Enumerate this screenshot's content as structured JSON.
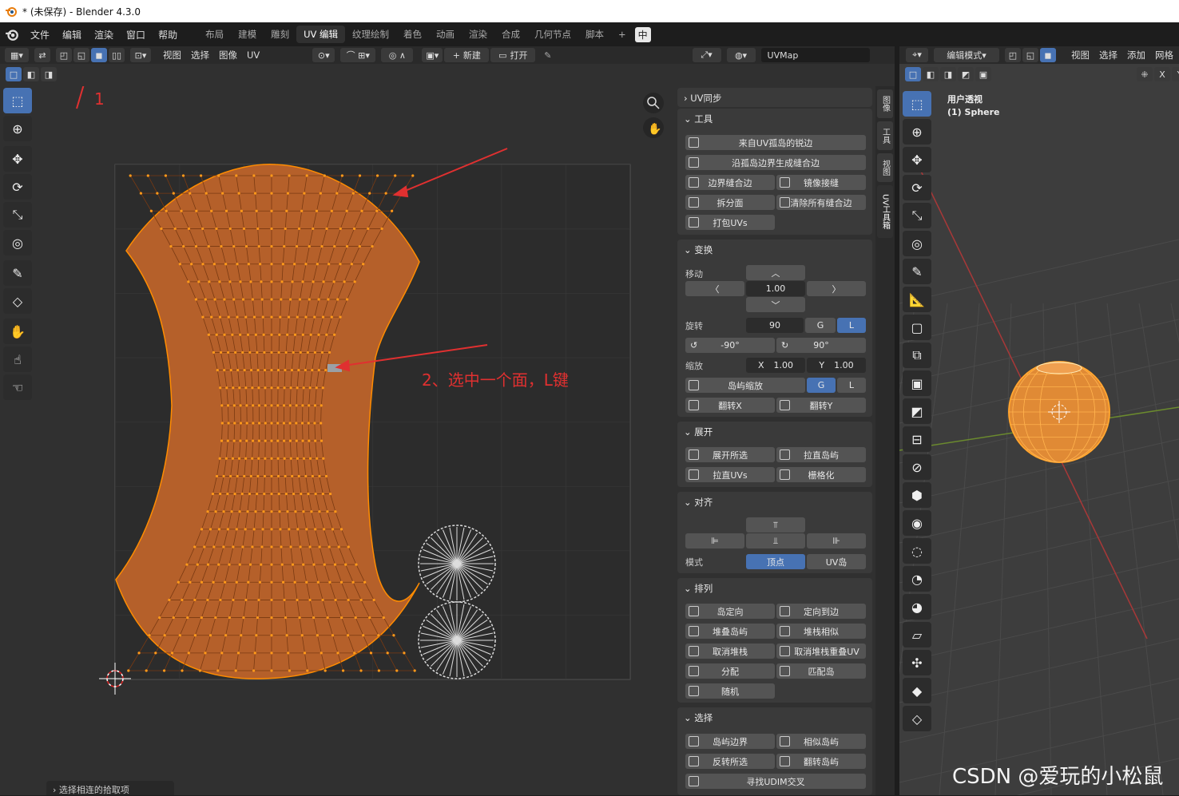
{
  "window": {
    "title": "* (未保存) - Blender 4.3.0"
  },
  "menubar": {
    "menus": [
      "文件",
      "编辑",
      "渲染",
      "窗口",
      "帮助"
    ],
    "workspaces": [
      "布局",
      "建模",
      "雕刻",
      "UV 编辑",
      "纹理绘制",
      "着色",
      "动画",
      "渲染",
      "合成",
      "几何节点",
      "脚本"
    ],
    "active_workspace": "UV 编辑",
    "add_tab": "+",
    "ime": "中"
  },
  "uv_header": {
    "menus": [
      "视图",
      "选择",
      "图像",
      "UV"
    ],
    "new_label": "新建",
    "open_label": "打开",
    "uvmap": "UVMap"
  },
  "annotations": {
    "one": "1",
    "two": "2、选中一个面，L键"
  },
  "npanel": {
    "uv_sync": "UV同步",
    "tools": {
      "title": "工具",
      "seams_from_islands": "来自UV孤岛的锐边",
      "seams_from_border": "沿孤岛边界生成缝合边",
      "border_seam": "边界缝合边",
      "mirror_seam": "镜像接缝",
      "split_faces": "拆分面",
      "clear_seams": "清除所有缝合边",
      "pack_uvs": "打包UVs"
    },
    "transform": {
      "title": "变换",
      "move": "移动",
      "move_value": "1.00",
      "rotate": "旋转",
      "rotate_value": "90",
      "g": "G",
      "l": "L",
      "rot_neg": "-90°",
      "rot_pos": "90°",
      "scale": "缩放",
      "x": "X",
      "y": "Y",
      "scale_x": "1.00",
      "scale_y": "1.00",
      "island_scale": "岛屿缩放",
      "flip_x": "翻转X",
      "flip_y": "翻转Y"
    },
    "unwrap": {
      "title": "展开",
      "unwrap_sel": "展开所选",
      "straighten_island": "拉直岛屿",
      "straighten_uvs": "拉直UVs",
      "grid": "栅格化"
    },
    "align": {
      "title": "对齐",
      "mode": "模式",
      "vertex": "顶点",
      "uv_island": "UV岛"
    },
    "arrange": {
      "title": "排列",
      "orient_island": "岛定向",
      "orient_edge": "定向到边",
      "stack_islands": "堆叠岛屿",
      "stack_similar": "堆栈相似",
      "unstack": "取消堆栈",
      "unstack_overlap": "取消堆栈重叠UV",
      "distribute": "分配",
      "match_island": "匹配岛",
      "random": "随机"
    },
    "select": {
      "title": "选择",
      "island_border": "岛屿边界",
      "similar_island": "相似岛屿",
      "invert": "反转所选",
      "flip_island": "翻转岛屿",
      "find_udim": "寻找UDIM交叉"
    }
  },
  "sidetabs": [
    "图像",
    "工具",
    "视图",
    "UV工具箱"
  ],
  "viewport3d": {
    "mode": "编辑模式",
    "menus": [
      "视图",
      "选择",
      "添加",
      "网格"
    ],
    "view_label": "用户透视",
    "object_label": "(1) Sphere",
    "axis_x": "X",
    "axis_y": "Y"
  },
  "status": {
    "last_op": "选择相连的拾取项"
  },
  "watermark": "CSDN @爱玩的小松鼠",
  "colors": {
    "selected_uv": "#c46a2e",
    "uv_vertex": "#ff8c00",
    "accent": "#4772b3",
    "annotation": "#e03030"
  }
}
